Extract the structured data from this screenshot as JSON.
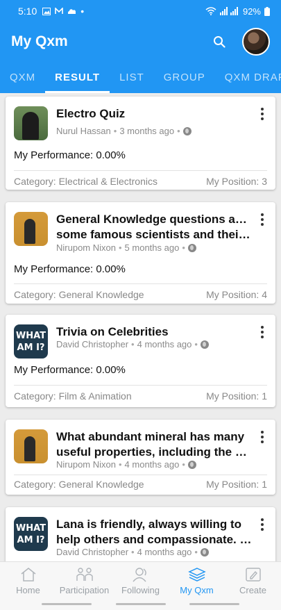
{
  "status_bar": {
    "time": "5:10",
    "battery": "92%"
  },
  "app_bar": {
    "title": "My Qxm"
  },
  "tabs": [
    {
      "label": "QXM"
    },
    {
      "label": "RESULT",
      "active": true
    },
    {
      "label": "LIST"
    },
    {
      "label": "GROUP"
    },
    {
      "label": "QXM DRAFT"
    }
  ],
  "cards": [
    {
      "title_lines": [
        "Electro Quiz"
      ],
      "author": "Nurul Hassan",
      "time": "3 months ago",
      "performance": "My Performance: 0.00%",
      "category": "Category: Electrical & Electronics",
      "position": "My Position: 3",
      "thumb": "person-green"
    },
    {
      "title_lines": [
        "General Knowledge questions about",
        "some famous scientists and their i..."
      ],
      "author": "Nirupom Nixon",
      "time": "5 months ago",
      "performance": "My Performance: 0.00%",
      "category": "Category: General Knowledge",
      "position": "My Position: 4",
      "thumb": "person-yellow"
    },
    {
      "title_lines": [
        "Trivia on Celebrities"
      ],
      "author": "David Christopher",
      "time": "4 months ago",
      "performance": "My Performance: 0.00%",
      "category": "Category: Film & Animation",
      "position": "My Position: 1",
      "thumb": "what-am-i",
      "thumb_text": [
        "WHAT",
        "AM I?"
      ]
    },
    {
      "title_lines": [
        "What abundant mineral has many",
        "useful properties, including the pie..."
      ],
      "author": "Nirupom Nixon",
      "time": "4 months ago",
      "category": "Category: General Knowledge",
      "position": "My Position: 1",
      "thumb": "person-yellow"
    },
    {
      "title_lines": [
        "Lana is friendly, always willing to",
        "help others and compassionate. W..."
      ],
      "author": "David Christopher",
      "time": "4 months ago",
      "thumb": "what-am-i",
      "thumb_text": [
        "WHAT",
        "AM I?"
      ]
    }
  ],
  "bottom_nav": [
    {
      "label": "Home",
      "icon": "home-icon"
    },
    {
      "label": "Participation",
      "icon": "participation-icon"
    },
    {
      "label": "Following",
      "icon": "following-icon"
    },
    {
      "label": "My Qxm",
      "icon": "layers-icon",
      "active": true
    },
    {
      "label": "Create",
      "icon": "create-icon"
    }
  ],
  "colors": {
    "primary": "#2196f3",
    "background": "#ececec"
  }
}
